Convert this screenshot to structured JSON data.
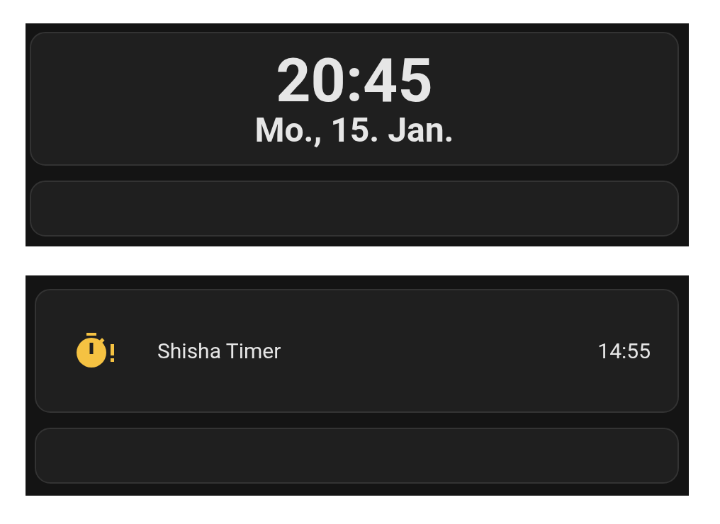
{
  "clock": {
    "time": "20:45",
    "date": "Mo., 15. Jan."
  },
  "timer": {
    "name": "Shisha Timer",
    "remaining": "14:55"
  }
}
